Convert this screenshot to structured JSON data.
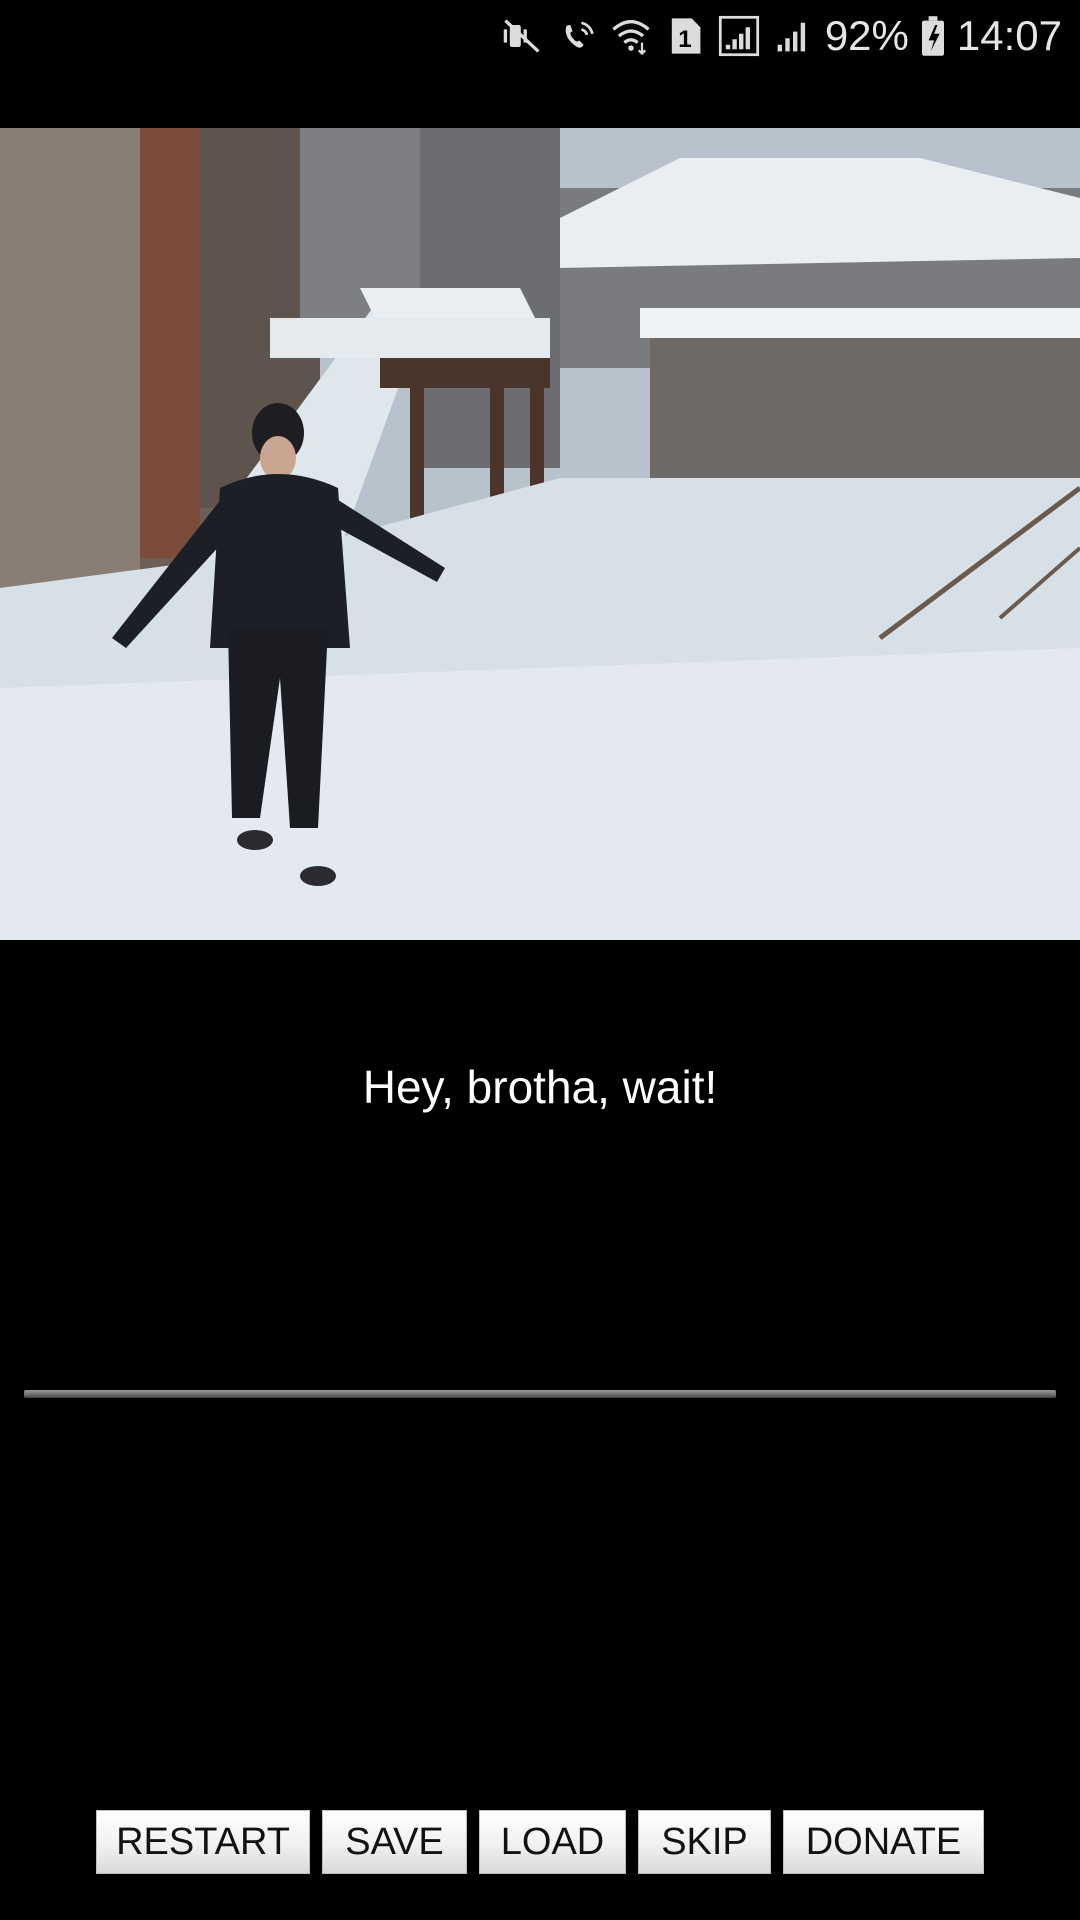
{
  "status_bar": {
    "battery_percent": "92%",
    "time": "14:07",
    "sim_badge": "1",
    "icons": [
      "mute-vibrate-icon",
      "wifi-calling-icon",
      "wifi-icon",
      "sim-1-icon",
      "signal-icon",
      "signal-icon-2",
      "battery-charging-icon"
    ]
  },
  "scene": {
    "description_icon": "video-frame"
  },
  "dialogue": {
    "text": "Hey, brotha, wait!"
  },
  "buttons": {
    "restart": "RESTART",
    "save": "SAVE",
    "load": "LOAD",
    "skip": "SKIP",
    "donate": "DONATE"
  }
}
